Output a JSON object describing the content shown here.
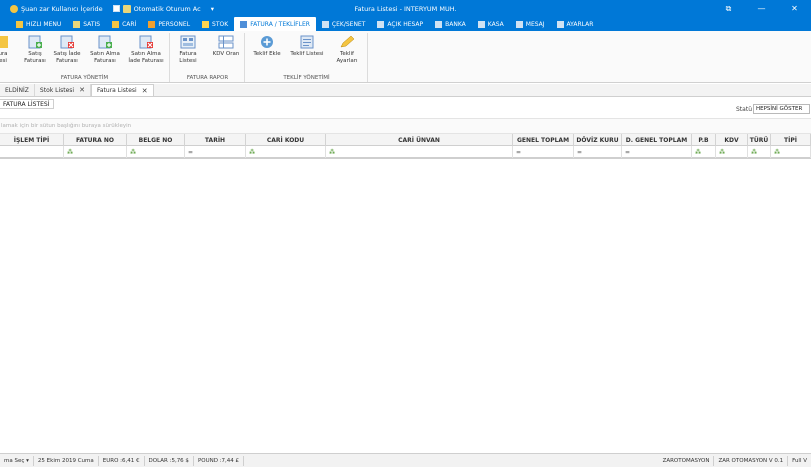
{
  "titlebar": {
    "title": "Fatura Listesi - INTERYUM MUH.",
    "user_status": "Şuan zar Kullanıcı İçeride",
    "auto_login": "Otomatik Oturum Ac",
    "dropdown_arrow": "▾",
    "pin_glyph": "⧉",
    "min_glyph": "—",
    "close_glyph": "✕",
    "accent": "#0078d7"
  },
  "ribbon_tabs": [
    {
      "label": "HIZLI MENU",
      "icon": "lightning-icon",
      "color": "#f4c542"
    },
    {
      "label": "SATIS",
      "icon": "cash-icon",
      "color": "#e8d67a"
    },
    {
      "label": "CARİ",
      "icon": "people-icon",
      "color": "#f4c542"
    },
    {
      "label": "PERSONEL",
      "icon": "person-icon",
      "color": "#f0a030"
    },
    {
      "label": "STOK",
      "icon": "box-icon",
      "color": "#ffd54f"
    },
    {
      "label": "FATURA / TEKLİFLER",
      "icon": "invoice-icon",
      "color": "#4f8fd8",
      "active": true
    },
    {
      "label": "ÇEK/SENET",
      "icon": "check-icon",
      "color": "#cfe2f3"
    },
    {
      "label": "AÇIK HESAP",
      "icon": "open-account-icon",
      "color": "#cfe2f3"
    },
    {
      "label": "BANKA",
      "icon": "bank-icon",
      "color": "#cfe2f3"
    },
    {
      "label": "KASA",
      "icon": "safe-icon",
      "color": "#cfe2f3"
    },
    {
      "label": "MESAJ",
      "icon": "message-icon",
      "color": "#cfe2f3"
    },
    {
      "label": "AYARLAR",
      "icon": "gear-icon",
      "color": "#cfe2f3"
    }
  ],
  "ribbon": {
    "group1_title": "FATURA YÖNETİM",
    "group2_title": "FATURA RAPOR",
    "group3_title": "TEKLİF YÖNETİMİ",
    "buttons": {
      "partial_l1": "ura",
      "partial_l2": "esi",
      "sales_invoice_l1": "Satış",
      "sales_invoice_l2": "Faturası",
      "sales_return_l1": "Satış İade",
      "sales_return_l2": "Faturası",
      "purchase_l1": "Satın Alma",
      "purchase_l2": "Faturası",
      "purchase_return_l1": "Satın Alma",
      "purchase_return_l2": "İade Faturası",
      "invoice_list_l1": "Fatura",
      "invoice_list_l2": "Listesi",
      "vat_rate": "KDV Oran",
      "add_offer": "Teklif Ekle",
      "offer_list": "Teklif Listesi",
      "offer_settings_l1": "Teklif",
      "offer_settings_l2": "Ayarları"
    }
  },
  "doc_tabs": [
    {
      "label": "ELDİNİZ",
      "closable": false
    },
    {
      "label": "Stok Listesi",
      "closable": true
    },
    {
      "label": "Fatura Listesi",
      "closable": true,
      "active": true
    }
  ],
  "doc_tab_close": "✕",
  "page": {
    "title": "FATURA LİSTESİ",
    "status_label": "Statü",
    "status_value": "HEPSİNİ GÖSTER",
    "group_hint": "lamak için bir sütun başlığını buraya sürükleyin"
  },
  "grid": {
    "columns": [
      "İŞLEM TİPİ",
      "FATURA NO",
      "BELGE NO",
      "TARİH",
      "CARİ KODU",
      "CARİ ÜNVAN",
      "GENEL TOPLAM",
      "DÖVİZ KURU",
      "D. GENEL TOPLAM",
      "P.B",
      "KDV",
      "TÜRÜ",
      "TİPİ"
    ],
    "filter_glyphs": [
      "",
      "⁂",
      "⁂",
      "=",
      "⁂",
      "⁂",
      "=",
      "=",
      "=",
      "⁂",
      "⁂",
      "⁂",
      "⁂"
    ]
  },
  "statusbar": {
    "left_select": "ma Seç",
    "left_arrow": "▾",
    "date": "25 Ekim 2019 Cuma",
    "euro": "EURO :6,41 €",
    "dollar": "DOLAR :5,76 $",
    "pound": "POUND :7,44 £",
    "company": "ZAROTOMASYON",
    "version": "ZAR OTOMASYON V 0.1",
    "fullv": "Full V"
  }
}
